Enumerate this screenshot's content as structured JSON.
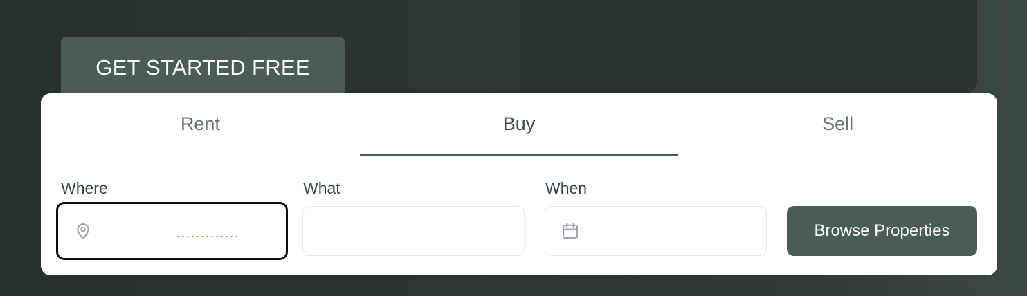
{
  "hero": {
    "cta_label": "GET STARTED FREE"
  },
  "search": {
    "tabs": [
      {
        "label": "Rent",
        "active": false
      },
      {
        "label": "Buy",
        "active": true
      },
      {
        "label": "Sell",
        "active": false
      }
    ],
    "where": {
      "label": "Where",
      "value": "",
      "icon": "map-pin-icon",
      "focused": true
    },
    "what": {
      "label": "What",
      "value": ""
    },
    "when": {
      "label": "When",
      "value": "",
      "icon": "calendar-icon"
    },
    "submit_label": "Browse Properties"
  },
  "colors": {
    "background": "#2b3634",
    "accent": "#4a5c58",
    "card": "#ffffff",
    "focus_border": "#111111",
    "spellcheck": "#f06a50"
  }
}
